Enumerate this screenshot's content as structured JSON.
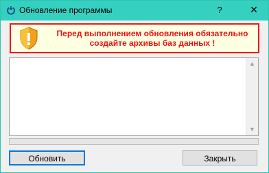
{
  "window": {
    "title": "Обновление программы",
    "help_label": "?",
    "close_label": "✕"
  },
  "warning": {
    "line1": "Перед выполнением обновления обязательно",
    "line2": "создайте архивы баз данных !",
    "text_color": "#ee1111",
    "border_color": "#e81b1b",
    "icon": "shield-warning-icon"
  },
  "log": {
    "text": ""
  },
  "progress": {
    "value": 0
  },
  "buttons": {
    "update_label": "Обновить",
    "close_label": "Закрыть"
  },
  "colors": {
    "titlebar": "#35d0bf",
    "accent": "#0078d7"
  }
}
